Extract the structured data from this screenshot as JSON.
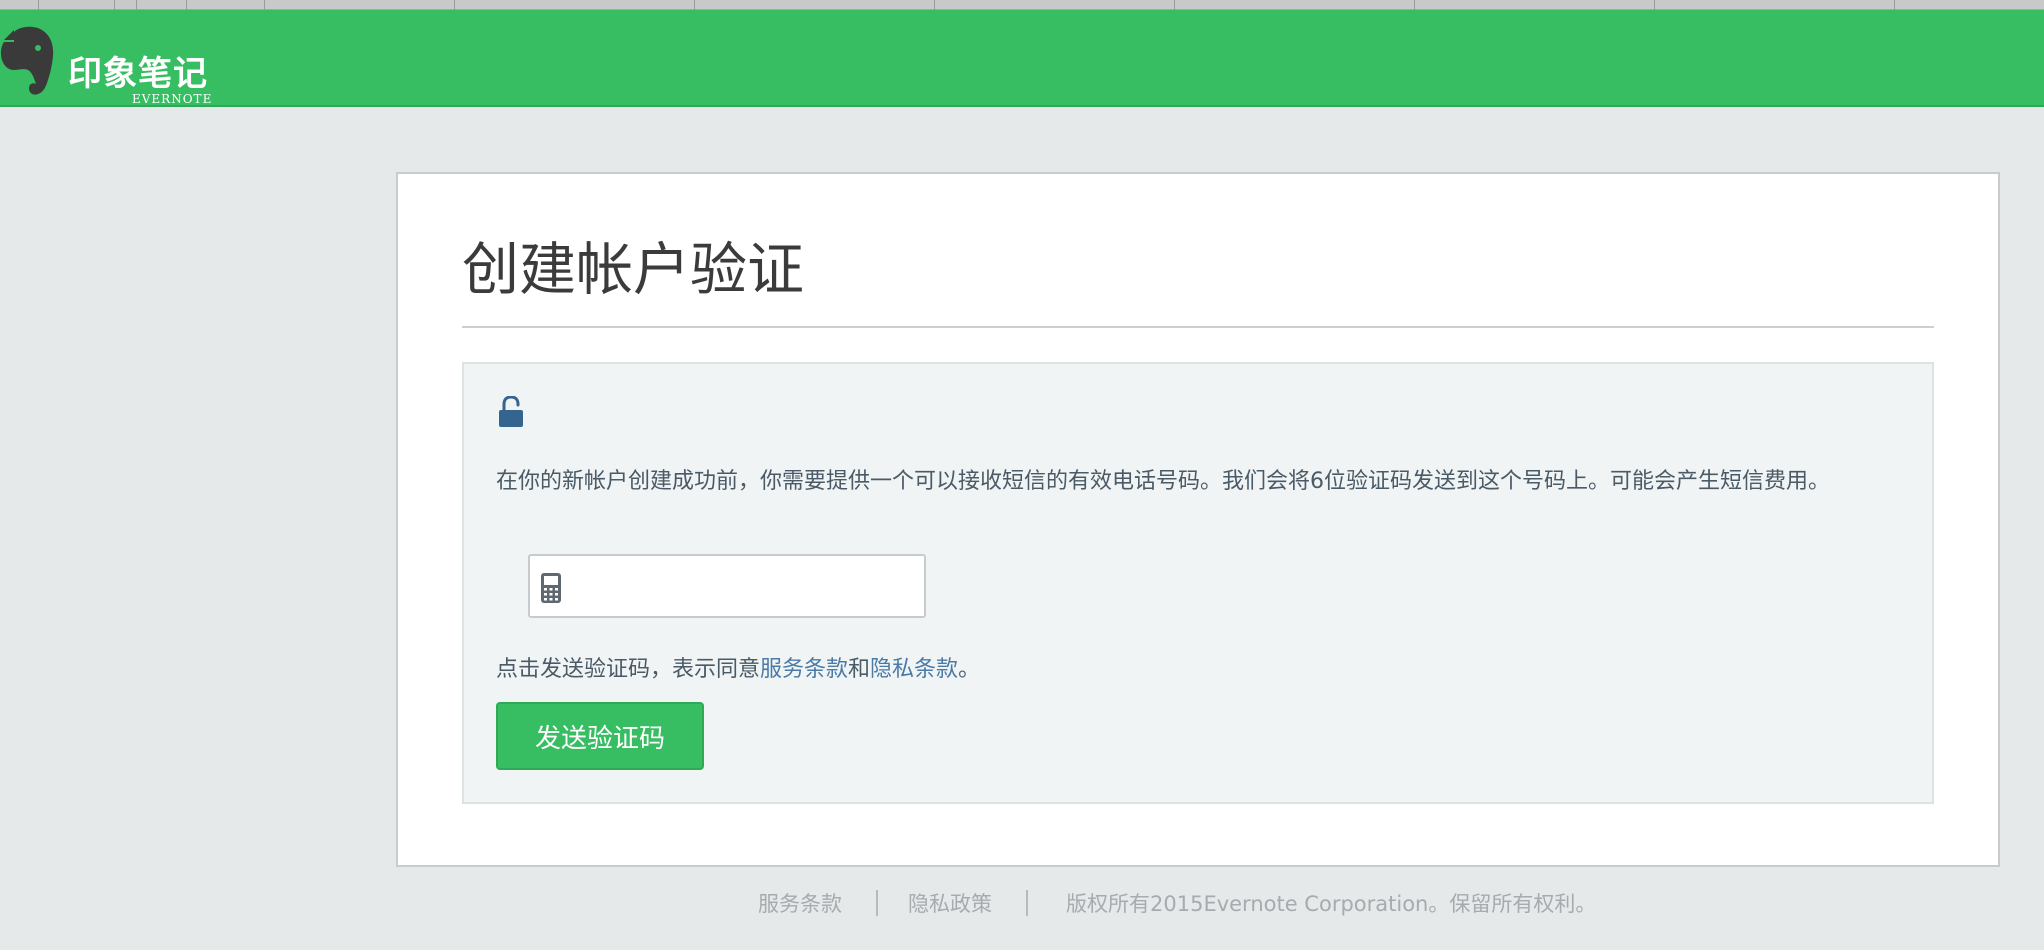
{
  "header": {
    "brand_cn": "印象笔记",
    "brand_en": "EVERNOTE"
  },
  "card": {
    "title": "创建帐户验证",
    "info_text": "在你的新帐户创建成功前，你需要提供一个可以接收短信的有效电话号码。我们会将6位验证码发送到这个号码上。可能会产生短信费用。",
    "phone_input": {
      "value": "",
      "placeholder": ""
    },
    "agree": {
      "prefix": "点击发送验证码，表示同意",
      "terms_link": "服务条款",
      "conjunction": "和",
      "privacy_link": "隐私条款",
      "suffix": "。"
    },
    "send_button_label": "发送验证码"
  },
  "footer": {
    "terms": "服务条款",
    "privacy": "隐私政策",
    "copyright": "版权所有2015Evernote Corporation。保留所有权利。"
  },
  "icons": {
    "logo": "evernote-elephant-icon",
    "lock": "unlock-icon",
    "phone": "mobile-phone-icon"
  },
  "colors": {
    "brand_green": "#37bd62",
    "link_blue": "#4a7aa6",
    "background": "#e6e9ea"
  }
}
